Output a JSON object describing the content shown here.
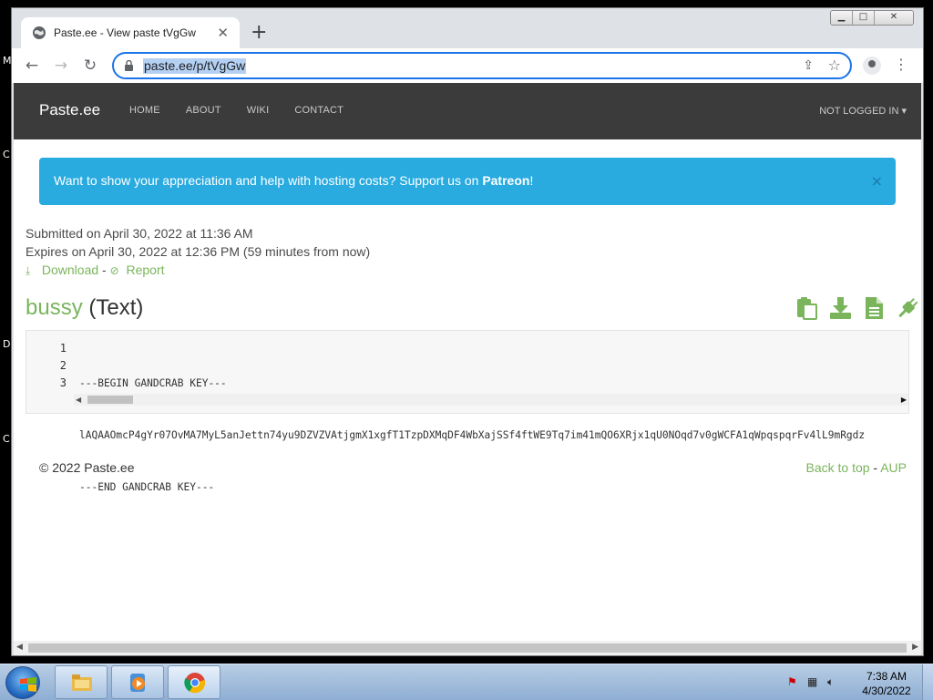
{
  "desktop": {
    "side_letters": [
      "M",
      "C",
      "D",
      "C"
    ]
  },
  "browser": {
    "tab_title": "Paste.ee - View paste tVgGw",
    "new_tab_symbol": "+",
    "url": "paste.ee/p/tVgGw",
    "window_buttons": [
      "minimize",
      "maximize",
      "close"
    ]
  },
  "site": {
    "brand": "Paste.ee",
    "nav": [
      "HOME",
      "ABOUT",
      "WIKI",
      "CONTACT"
    ],
    "login": "NOT LOGGED IN",
    "alert_text": "Want to show your appreciation and help with hosting costs? Support us on ",
    "alert_link": "Patreon",
    "alert_end": "!",
    "alert_close": "×",
    "submitted": "Submitted on April 30, 2022 at 11:36 AM",
    "expires": "Expires on April 30, 2022 at 12:36 PM (59 minutes from now)",
    "download_label": "Download",
    "separator": " - ",
    "report_label": "Report",
    "paste_name": "bussy",
    "paste_type": "(Text)",
    "action_icons": [
      "copy-icon",
      "download-icon",
      "raw-file-icon",
      "plug-icon"
    ],
    "lines": [
      {
        "num": "1",
        "text": "---BEGIN GANDCRAB KEY---"
      },
      {
        "num": "2",
        "text": "lAQAAOmcP4gYr07OvMA7MyL5anJettn74yu9DZVZVAtjgmX1xgfT1TzpDXMqDF4WbXajSSf4ftWE9Tq7im41mQO6XRjx1qU0NOqd7v0gWCFA1qWpqspqrFv4lL9mRgdz"
      },
      {
        "num": "3",
        "text": "---END GANDCRAB KEY---"
      }
    ],
    "footer_copyright": "© 2022 Paste.ee",
    "footer_back_to_top": "Back to top",
    "footer_dash": " - ",
    "footer_aup": "AUP"
  },
  "taskbar": {
    "apps": [
      "windows-explorer",
      "media-player",
      "google-chrome"
    ],
    "time": "7:38 AM",
    "date": "4/30/2022"
  },
  "colors": {
    "accent_green": "#7ab55c",
    "alert_blue": "#29abe0",
    "navbar": "#3b3b3b"
  }
}
